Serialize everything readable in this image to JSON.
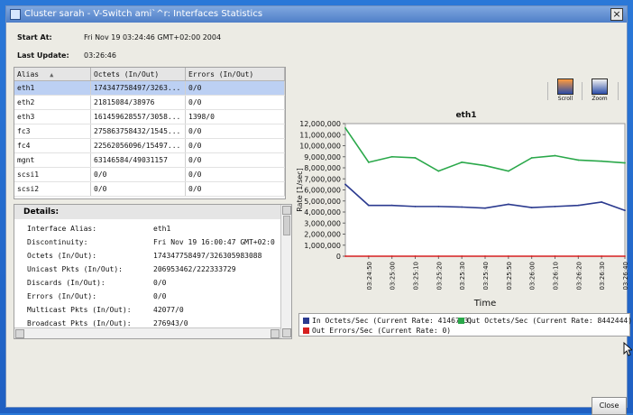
{
  "window": {
    "title": "Cluster sarah - V-Switch ami`^r: Interfaces Statistics",
    "close_symbol": "×"
  },
  "meta": {
    "start_at_label": "Start At:",
    "start_at_value": "Fri Nov 19 03:24:46 GMT+02:00 2004",
    "last_update_label": "Last Update:",
    "last_update_value": "03:26:46"
  },
  "table": {
    "headers": [
      "Alias",
      "Octets (In/Out)",
      "Errors (In/Out)"
    ],
    "sort_indicator": "▲",
    "rows": [
      [
        "eth1",
        "174347758497/3263...",
        "0/0"
      ],
      [
        "eth2",
        "21815084/38976",
        "0/0"
      ],
      [
        "eth3",
        "161459628557/3058...",
        "1398/0"
      ],
      [
        "fc3",
        "275863758432/1545...",
        "0/0"
      ],
      [
        "fc4",
        "22562056096/15497...",
        "0/0"
      ],
      [
        "mgnt",
        "63146584/49031157",
        "0/0"
      ],
      [
        "scsi1",
        "0/0",
        "0/0"
      ],
      [
        "scsi2",
        "0/0",
        "0/0"
      ]
    ],
    "selected_index": 0
  },
  "details": {
    "title": "Details:",
    "rows": [
      {
        "label": "Interface Alias:",
        "value": "eth1"
      },
      {
        "label": "Discontinuity:",
        "value": "Fri Nov 19 16:00:47 GMT+02:0"
      },
      {
        "label": "Octets (In/Out):",
        "value": "174347758497/326305983088"
      },
      {
        "label": "Unicast Pkts (In/Out):",
        "value": "206953462/222333729"
      },
      {
        "label": "Discards (In/Out):",
        "value": "0/0"
      },
      {
        "label": "Errors (In/Out):",
        "value": "0/0"
      },
      {
        "label": "Multicast Pkts (In/Out):",
        "value": "42077/0"
      },
      {
        "label": "Broadcast Pkts (In/Out):",
        "value": "276943/0"
      }
    ]
  },
  "toolbar": {
    "scroll_label": "Scroll",
    "zoom_label": "Zoom"
  },
  "chart_data": {
    "type": "line",
    "title": "eth1",
    "xlabel": "Time",
    "ylabel": "Rate [1/sec]",
    "x": [
      "03:24:50",
      "03:25:00",
      "03:25:10",
      "03:25:20",
      "03:25:30",
      "03:25:40",
      "03:25:50",
      "03:26:00",
      "03:26:10",
      "03:26:20",
      "03:26:30",
      "03:26:40"
    ],
    "ylim": [
      0,
      12000000
    ],
    "yticks": [
      "12,000,000",
      "11,000,000",
      "10,000,000",
      "9,000,000",
      "8,000,000",
      "7,000,000",
      "6,000,000",
      "5,000,000",
      "4,000,000",
      "3,000,000",
      "2,000,000",
      "1,000,000",
      "0"
    ],
    "series": [
      {
        "name": "In Octets/Sec (Current Rate: 4146713)",
        "color": "#2b3a8f",
        "values": [
          6500000,
          4600000,
          4600000,
          4500000,
          4500000,
          4450000,
          4350000,
          4700000,
          4400000,
          4500000,
          4600000,
          4900000,
          4146713
        ]
      },
      {
        "name": "Out Octets/Sec (Current Rate: 8442444)",
        "color": "#2aa84a",
        "values": [
          11600000,
          8500000,
          9000000,
          8900000,
          7700000,
          8500000,
          8200000,
          7700000,
          8900000,
          9100000,
          8700000,
          8600000,
          8442444
        ]
      },
      {
        "name": "Out Errors/Sec (Current Rate: 0)",
        "color": "#d62020",
        "values": [
          0,
          0,
          0,
          0,
          0,
          0,
          0,
          0,
          0,
          0,
          0,
          0,
          0
        ]
      }
    ],
    "x_points": [
      "03:24:45",
      "03:24:50",
      "03:25:00",
      "03:25:10",
      "03:25:20",
      "03:25:30",
      "03:25:40",
      "03:25:50",
      "03:26:00",
      "03:26:10",
      "03:26:20",
      "03:26:30",
      "03:26:45"
    ],
    "grid": false,
    "legend_position": "bottom"
  },
  "buttons": {
    "close_label": "Close"
  }
}
